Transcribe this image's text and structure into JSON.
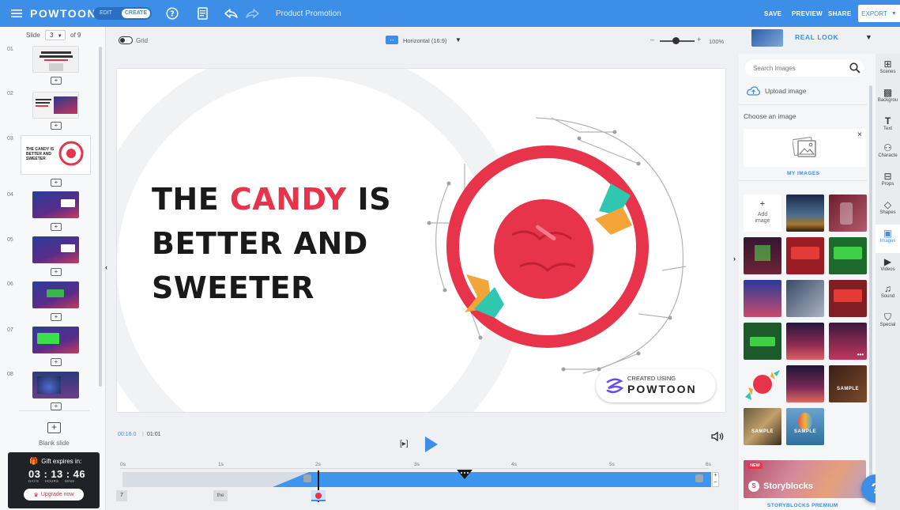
{
  "topbar": {
    "brand": "POWTOON",
    "mode_edit": "EDIT",
    "mode_create": "CREATE",
    "project_title": "Product Promotion",
    "save": "SAVE",
    "preview": "PREVIEW",
    "share": "SHARE",
    "export": "EXPORT"
  },
  "slides_panel": {
    "label": "Slide",
    "current": "3",
    "total_label": "of 9",
    "numbers": [
      "01",
      "02",
      "03",
      "04",
      "05",
      "06",
      "07",
      "08"
    ],
    "blank_slide": "Blank slide",
    "thumb3_line1": "THE CANDY IS",
    "thumb3_line2": "BETTER AND",
    "thumb3_line3": "SWEETER"
  },
  "gift": {
    "title": "Gift expires in:",
    "days": "03",
    "hours": "13",
    "mins": "46",
    "days_label": "DAYS",
    "hours_label": "HOURS",
    "mins_label": "MINS",
    "upgrade": "Upgrade now"
  },
  "canvas_toolbar": {
    "grid": "Grid",
    "orientation": "Horizontal (16:9)",
    "zoom": "100%"
  },
  "slide": {
    "line1_a": "THE ",
    "line1_accent": "CANDY",
    "line1_b": " IS",
    "line2": "BETTER AND",
    "line3": "SWEETER",
    "watermark_top": "CREATED USING",
    "watermark_brand": "POWTOON"
  },
  "player": {
    "current_time": "00:16.0",
    "total_time": "01:01",
    "play_bracket": "[▸]"
  },
  "timeline": {
    "ticks": [
      "0s",
      "1s",
      "2s",
      "3s",
      "4s",
      "5s",
      "6s"
    ],
    "layer_7": "7",
    "layer_the": "the"
  },
  "right_panel": {
    "style_name": "REAL LOOK",
    "search_placeholder": "Search Images",
    "upload": "Upload image",
    "choose": "Choose an image",
    "my_images": "MY IMAGES",
    "add_image_line1": "Add",
    "add_image_line2": "image",
    "sample": "SAMPLE",
    "new_badge": "NEW",
    "storyblocks": "Storyblocks",
    "storyblocks_premium": "STORYBLOCKS PREMIUM",
    "help": "?"
  },
  "rail": [
    "Scenes",
    "Backgrou",
    "Text",
    "Characte",
    "Props",
    "Shapes",
    "Images",
    "Videos",
    "Sound",
    "Special"
  ],
  "colors": {
    "brand_blue": "#3d8ee6",
    "candy_red": "#e8344b",
    "dark_gift": "#1f2328"
  }
}
